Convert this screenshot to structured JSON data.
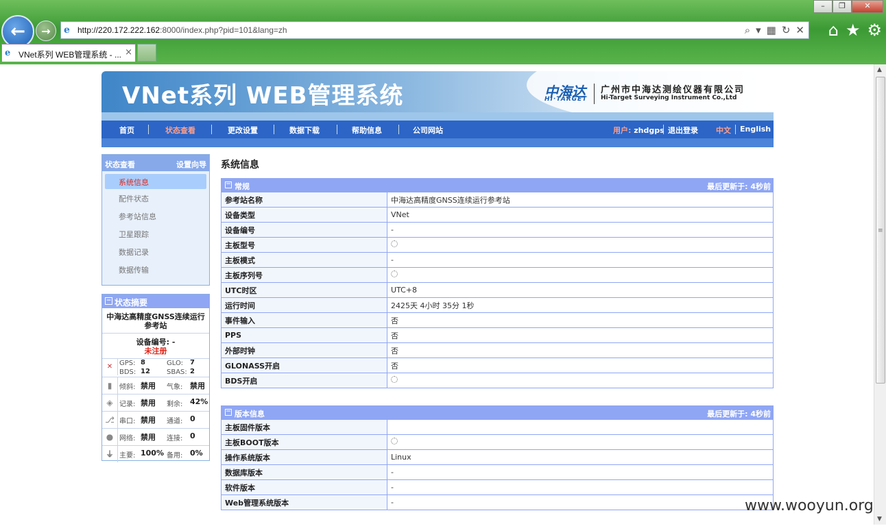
{
  "browser": {
    "url_prefix": "http://220.172.222.162",
    "url_rest": ":8000/index.php?pid=101&lang=zh",
    "tab_title": "VNet系列 WEB管理系统 - ...",
    "win_minimize": "–",
    "win_restore": "❐",
    "win_close": "✕"
  },
  "banner": {
    "title": "VNet系列 WEB管理系统",
    "logo_cn": "中海达",
    "logo_en": "HI·TARGET",
    "company_cn": "广州市中海达测绘仪器有限公司",
    "company_en": "Hi-Target Surveying Instrument Co.,Ltd"
  },
  "nav": {
    "items": [
      "首页",
      "状态查看",
      "更改设置",
      "数据下载",
      "帮助信息",
      "公司网站"
    ],
    "user_label": "用户:",
    "user_name": "zhdgps",
    "logout": "退出登录",
    "lang_cn": "中文",
    "lang_en": "English"
  },
  "sidebar": {
    "header_left": "状态查看",
    "header_right": "设置向导",
    "items": [
      "系统信息",
      "配件状态",
      "参考站信息",
      "卫星跟踪",
      "数据记录",
      "数据传输"
    ]
  },
  "summary": {
    "title": "状态摘要",
    "station_name": "中海达高精度GNSS连续运行参考站",
    "device_label": "设备编号: -",
    "reg_status": "未注册",
    "gps_k": "GPS:",
    "gps_v": "8",
    "glo_k": "GLO:",
    "glo_v": "7",
    "bds_k": "BDS:",
    "bds_v": "12",
    "sbas_k": "SBAS:",
    "sbas_v": "2",
    "tilt_k": "倾斜:",
    "tilt_v": "禁用",
    "met_k": "气象:",
    "met_v": "禁用",
    "rec_k": "记录:",
    "rec_v": "禁用",
    "remain_k": "剩余:",
    "remain_v": "42%",
    "serial_k": "串口:",
    "serial_v": "禁用",
    "channel_k": "通道:",
    "channel_v": "0",
    "net_k": "网络:",
    "net_v": "禁用",
    "conn_k": "连接:",
    "conn_v": "0",
    "main_k": "主要:",
    "main_v": "100%",
    "backup_k": "备用:",
    "backup_v": "0%"
  },
  "main": {
    "title": "系统信息",
    "general": {
      "title": "常规",
      "updated": "最后更新于:  4秒前",
      "rows": [
        {
          "k": "参考站名称",
          "v": "中海达高精度GNSS连续运行参考站"
        },
        {
          "k": "设备类型",
          "v": "VNet"
        },
        {
          "k": "设备编号",
          "v": "-"
        },
        {
          "k": "主板型号",
          "v": "",
          "loading": true
        },
        {
          "k": "主板模式",
          "v": "-"
        },
        {
          "k": "主板序列号",
          "v": "",
          "loading": true
        },
        {
          "k": "UTC时区",
          "v": "UTC+8"
        },
        {
          "k": "运行时间",
          "v": "2425天  4小时  35分  1秒"
        },
        {
          "k": "事件输入",
          "v": "否"
        },
        {
          "k": "PPS",
          "v": "否"
        },
        {
          "k": "外部时钟",
          "v": "否"
        },
        {
          "k": "GLONASS开启",
          "v": "否"
        },
        {
          "k": "BDS开启",
          "v": "",
          "loading": true
        }
      ]
    },
    "version": {
      "title": "版本信息",
      "updated": "最后更新于:  4秒前",
      "rows": [
        {
          "k": "主板固件版本",
          "v": ""
        },
        {
          "k": "主板BOOT版本",
          "v": "",
          "loading": true
        },
        {
          "k": "操作系统版本",
          "v": "Linux"
        },
        {
          "k": "数据库版本",
          "v": "-"
        },
        {
          "k": "软件版本",
          "v": "-"
        },
        {
          "k": "Web管理系统版本",
          "v": "-"
        }
      ]
    }
  },
  "watermark": "www.wooyun.org"
}
